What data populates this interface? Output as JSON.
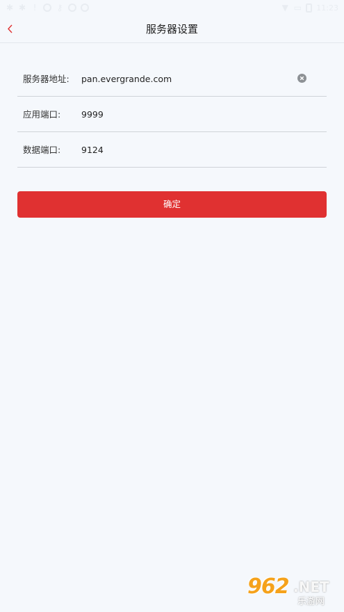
{
  "status_bar": {
    "time": "11:23"
  },
  "nav": {
    "title": "服务器设置"
  },
  "form": {
    "server_address": {
      "label": "服务器地址:",
      "value": "pan.evergrande.com"
    },
    "app_port": {
      "label": "应用端口:",
      "value": "9999"
    },
    "data_port": {
      "label": "数据端口:",
      "value": "9124"
    }
  },
  "confirm": {
    "label": "确定"
  },
  "watermark": {
    "number": "962",
    "suffix": ".NET",
    "subtitle": "乐游网"
  },
  "colors": {
    "accent": "#e03131",
    "background": "#f5f8fc",
    "back_arrow": "#e03131"
  }
}
